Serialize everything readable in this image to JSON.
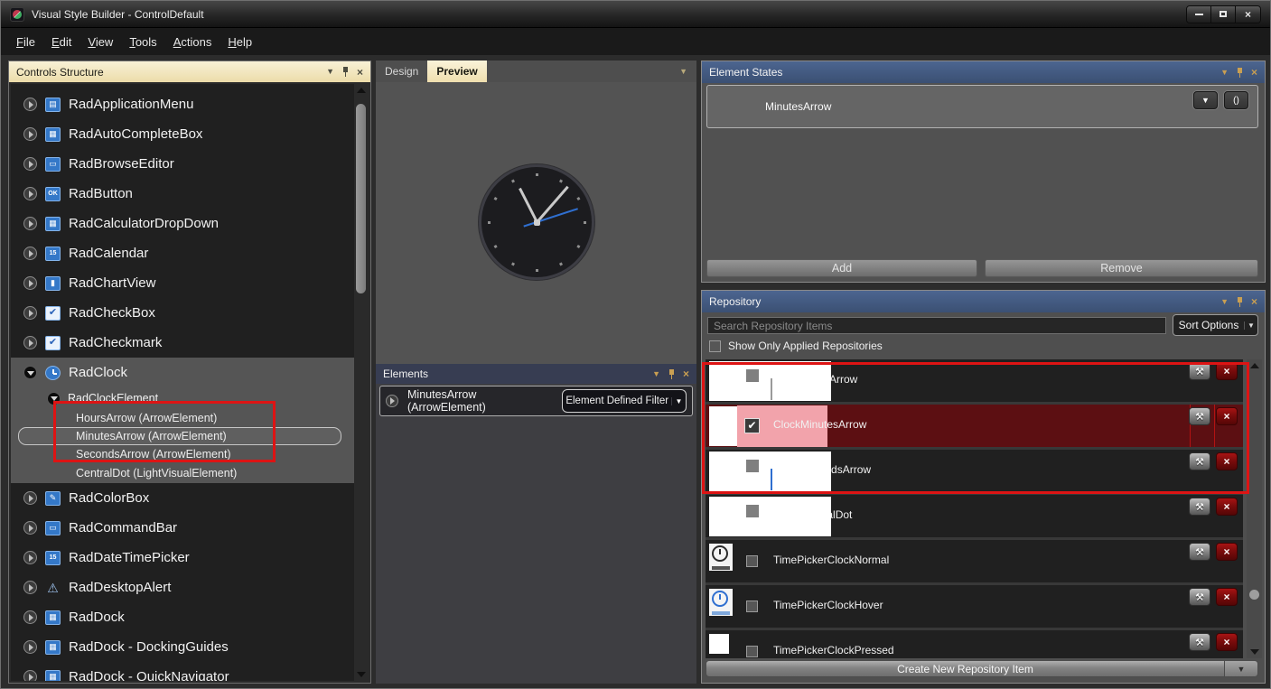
{
  "window": {
    "title": "Visual Style Builder - ControlDefault"
  },
  "menu": {
    "items": [
      "File",
      "Edit",
      "View",
      "Tools",
      "Actions",
      "Help"
    ]
  },
  "left_panel": {
    "title": "Controls Structure",
    "items": [
      {
        "label": "RadApplicationMenu",
        "glyph": "▤"
      },
      {
        "label": "RadAutoCompleteBox",
        "glyph": "▦"
      },
      {
        "label": "RadBrowseEditor",
        "glyph": "▭"
      },
      {
        "label": "RadButton",
        "glyph": "OK"
      },
      {
        "label": "RadCalculatorDropDown",
        "glyph": "▦"
      },
      {
        "label": "RadCalendar",
        "glyph": "15"
      },
      {
        "label": "RadChartView",
        "glyph": "▮"
      },
      {
        "label": "RadCheckBox",
        "glyph": "✔"
      },
      {
        "label": "RadCheckmark",
        "glyph": "✔"
      },
      {
        "label": "RadClock",
        "glyph": ""
      },
      {
        "label": "RadColorBox",
        "glyph": "✎"
      },
      {
        "label": "RadCommandBar",
        "glyph": "▭"
      },
      {
        "label": "RadDateTimePicker",
        "glyph": "15"
      },
      {
        "label": "RadDesktopAlert",
        "glyph": "⚠"
      },
      {
        "label": "RadDock",
        "glyph": "▦"
      },
      {
        "label": "RadDock - DockingGuides",
        "glyph": "▦"
      },
      {
        "label": "RadDock - QuickNavigator",
        "glyph": "▦"
      }
    ],
    "sub": {
      "parent": "RadClockElement",
      "children": [
        "HoursArrow (ArrowElement)",
        "MinutesArrow (ArrowElement)",
        "SecondsArrow (ArrowElement)",
        "CentralDot (LightVisualElement)"
      ],
      "selected": "MinutesArrow (ArrowElement)"
    }
  },
  "center": {
    "tabs": {
      "design": "Design",
      "preview": "Preview"
    },
    "elements_panel": {
      "title": "Elements",
      "row_label": "MinutesArrow (ArrowElement)",
      "filter_button": "Element Defined Filter"
    }
  },
  "element_states": {
    "title": "Element States",
    "state_item": "MinutesArrow",
    "add_button": "Add",
    "remove_button": "Remove"
  },
  "repository": {
    "title": "Repository",
    "search_placeholder": "Search Repository Items",
    "sort_button": "Sort Options",
    "show_only_label": "Show Only Applied Repositories",
    "items": [
      {
        "name": "ClockHoursArrow",
        "checked": false,
        "selected": false
      },
      {
        "name": "ClockMinutesArrow",
        "checked": true,
        "selected": true
      },
      {
        "name": "ClockSecondsArrow",
        "checked": false,
        "selected": false
      },
      {
        "name": "ClockCentralDot",
        "checked": false,
        "selected": false
      },
      {
        "name": "TimePickerClockNormal",
        "checked": false,
        "selected": false
      },
      {
        "name": "TimePickerClockHover",
        "checked": false,
        "selected": false
      },
      {
        "name": "TimePickerClockPressed",
        "checked": false,
        "selected": false
      }
    ],
    "create_button": "Create New Repository Item"
  },
  "icons": {
    "chevron_down": "▼",
    "tools": "⚒",
    "close": "×",
    "check": "✔",
    "parens": "()"
  },
  "colors": {
    "annotation_red": "#dd1414",
    "header_blue": "#41587e",
    "header_cream": "#f3e9c6",
    "selected_repo_row": "#5c0f12",
    "selected_repo_pink": "#f2a3ab",
    "second_hand_blue": "#2f6fd0"
  }
}
